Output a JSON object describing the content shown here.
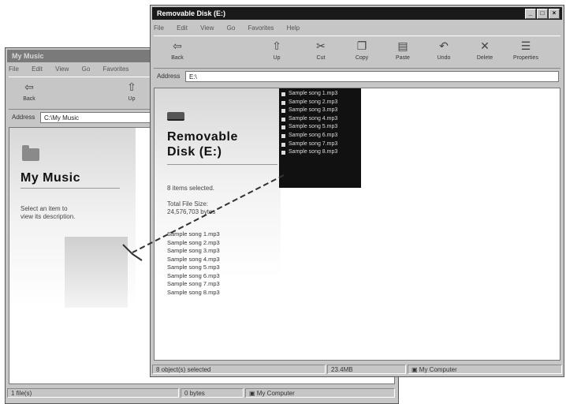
{
  "back_window": {
    "title": "My Music",
    "menu": [
      "File",
      "Edit",
      "View",
      "Go",
      "Favorites"
    ],
    "toolbar": {
      "back_label": "Back",
      "up_label": "Up"
    },
    "address": {
      "label": "Address",
      "value": "C:\\My Music"
    },
    "panel": {
      "title": "My Music",
      "hint_line1": "Select an item to",
      "hint_line2": "view its description."
    },
    "status": {
      "left": "1 file(s)",
      "middle": "0 bytes",
      "right": "My Computer"
    }
  },
  "front_window": {
    "title": "Removable Disk (E:)",
    "menu": [
      "File",
      "Edit",
      "View",
      "Go",
      "Favorites",
      "Help"
    ],
    "toolbar": {
      "back_label": "Back",
      "up_label": "Up",
      "cut_label": "Cut",
      "copy_label": "Copy",
      "paste_label": "Paste",
      "undo_label": "Undo",
      "delete_label": "Delete",
      "properties_label": "Properties"
    },
    "address": {
      "label": "Address",
      "value": "E:\\"
    },
    "panel": {
      "title_line1": "Removable",
      "title_line2": "Disk (E:)",
      "selected_text": "8 items selected.",
      "size_label": "Total File Size:",
      "size_value": "24,576,703 bytes",
      "files": [
        "Sample song 1.mp3",
        "Sample song 2.mp3",
        "Sample song 3.mp3",
        "Sample song 4.mp3",
        "Sample song 5.mp3",
        "Sample song 6.mp3",
        "Sample song 7.mp3",
        "Sample song 8.mp3"
      ]
    },
    "drag_items": [
      "Sample song 1.mp3",
      "Sample song 2.mp3",
      "Sample song 3.mp3",
      "Sample song 4.mp3",
      "Sample song 5.mp3",
      "Sample song 6.mp3",
      "Sample song 7.mp3",
      "Sample song 8.mp3"
    ],
    "status": {
      "left": "8 object(s) selected",
      "middle": "23.4MB",
      "right": "My Computer"
    }
  },
  "icons": {
    "back": "back-arrow-icon",
    "up": "up-folder-icon",
    "cut": "scissors-icon",
    "copy": "copy-icon",
    "paste": "paste-icon",
    "undo": "undo-icon",
    "delete": "delete-x-icon",
    "properties": "properties-icon",
    "folder": "folder-icon",
    "drive": "removable-drive-icon",
    "computer": "computer-icon"
  },
  "colors": {
    "title_active": "#1a1a1a",
    "title_inactive": "#7a7a7a",
    "window_face": "#c6c6c6",
    "popup_bg": "#111111"
  }
}
